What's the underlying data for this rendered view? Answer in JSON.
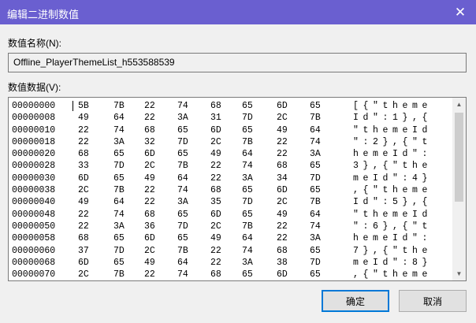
{
  "window": {
    "title": "编辑二进制数值",
    "close_glyph": "✕"
  },
  "value_name": {
    "label": "数值名称(N):",
    "value": "Offline_PlayerThemeList_h553588539"
  },
  "value_data": {
    "label": "数值数据(V):",
    "rows": [
      {
        "addr": "00000000",
        "hex": [
          "5B",
          "7B",
          "22",
          "74",
          "68",
          "65",
          "6D",
          "65"
        ],
        "ascii": "[{\"theme"
      },
      {
        "addr": "00000008",
        "hex": [
          "49",
          "64",
          "22",
          "3A",
          "31",
          "7D",
          "2C",
          "7B"
        ],
        "ascii": "Id\":1},{"
      },
      {
        "addr": "00000010",
        "hex": [
          "22",
          "74",
          "68",
          "65",
          "6D",
          "65",
          "49",
          "64"
        ],
        "ascii": "\"themeId"
      },
      {
        "addr": "00000018",
        "hex": [
          "22",
          "3A",
          "32",
          "7D",
          "2C",
          "7B",
          "22",
          "74"
        ],
        "ascii": "\":2},{\"t"
      },
      {
        "addr": "00000020",
        "hex": [
          "68",
          "65",
          "6D",
          "65",
          "49",
          "64",
          "22",
          "3A"
        ],
        "ascii": "hemeId\":"
      },
      {
        "addr": "00000028",
        "hex": [
          "33",
          "7D",
          "2C",
          "7B",
          "22",
          "74",
          "68",
          "65"
        ],
        "ascii": "3},{\"the"
      },
      {
        "addr": "00000030",
        "hex": [
          "6D",
          "65",
          "49",
          "64",
          "22",
          "3A",
          "34",
          "7D"
        ],
        "ascii": "meId\":4}"
      },
      {
        "addr": "00000038",
        "hex": [
          "2C",
          "7B",
          "22",
          "74",
          "68",
          "65",
          "6D",
          "65"
        ],
        "ascii": ",{\"theme"
      },
      {
        "addr": "00000040",
        "hex": [
          "49",
          "64",
          "22",
          "3A",
          "35",
          "7D",
          "2C",
          "7B"
        ],
        "ascii": "Id\":5},{"
      },
      {
        "addr": "00000048",
        "hex": [
          "22",
          "74",
          "68",
          "65",
          "6D",
          "65",
          "49",
          "64"
        ],
        "ascii": "\"themeId"
      },
      {
        "addr": "00000050",
        "hex": [
          "22",
          "3A",
          "36",
          "7D",
          "2C",
          "7B",
          "22",
          "74"
        ],
        "ascii": "\":6},{\"t"
      },
      {
        "addr": "00000058",
        "hex": [
          "68",
          "65",
          "6D",
          "65",
          "49",
          "64",
          "22",
          "3A"
        ],
        "ascii": "hemeId\":"
      },
      {
        "addr": "00000060",
        "hex": [
          "37",
          "7D",
          "2C",
          "7B",
          "22",
          "74",
          "68",
          "65"
        ],
        "ascii": "7},{\"the"
      },
      {
        "addr": "00000068",
        "hex": [
          "6D",
          "65",
          "49",
          "64",
          "22",
          "3A",
          "38",
          "7D"
        ],
        "ascii": "meId\":8}"
      },
      {
        "addr": "00000070",
        "hex": [
          "2C",
          "7B",
          "22",
          "74",
          "68",
          "65",
          "6D",
          "65"
        ],
        "ascii": ",{\"theme"
      }
    ]
  },
  "buttons": {
    "ok": "确定",
    "cancel": "取消"
  },
  "icons": {
    "scroll_up": "▲",
    "scroll_down": "▼"
  },
  "colors": {
    "titlebar": "#6a5fd0",
    "focus_border": "#0078d7"
  }
}
